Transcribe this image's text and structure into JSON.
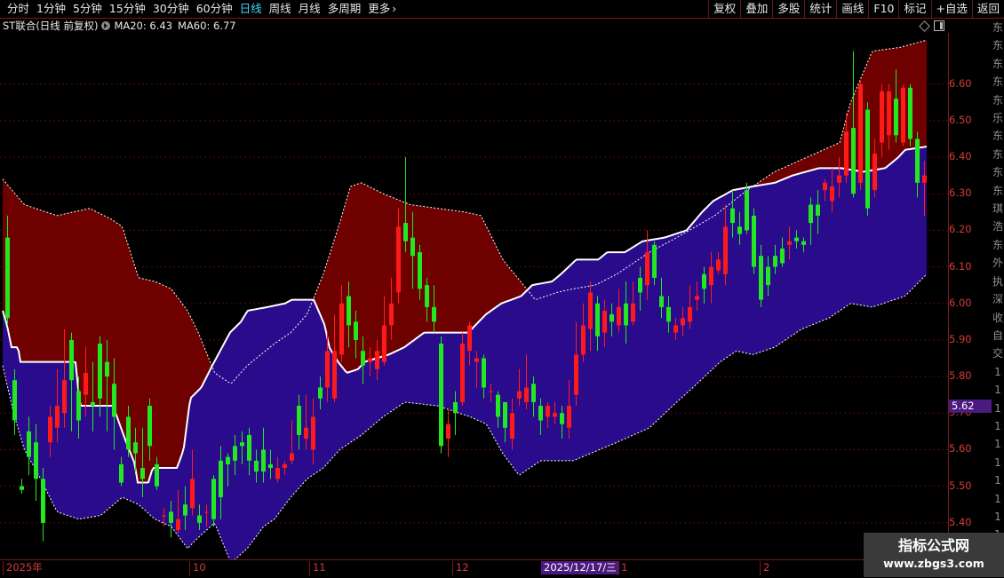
{
  "toolbar": {
    "periods": [
      "分时",
      "1分钟",
      "5分钟",
      "15分钟",
      "30分钟",
      "60分钟",
      "日线",
      "周线",
      "月线",
      "多周期",
      "更多"
    ],
    "active_period": "日线",
    "tools": [
      "复权",
      "叠加",
      "多股",
      "统计",
      "画线",
      "F10",
      "标记",
      "+自选",
      "返回"
    ]
  },
  "info": {
    "symbol": "ST联合(日线 前复权)",
    "ma20": "MA20: 6.43",
    "ma60": "MA60: 6.77"
  },
  "y_axis": {
    "labels": [
      "6.60",
      "6.50",
      "6.40",
      "6.30",
      "6.20",
      "6.10",
      "6.00",
      "5.90",
      "5.80",
      "5.70",
      "5.60",
      "5.50",
      "5.40"
    ],
    "current_price": "5.62"
  },
  "x_axis": {
    "labels": [
      "2025年",
      "10",
      "11",
      "12",
      "1",
      "2"
    ],
    "cursor_date": "2025/12/17/三"
  },
  "right_strip": [
    "东",
    "东",
    "东",
    "东",
    "东",
    "乐",
    "东",
    "东",
    "东",
    "东",
    "琪",
    "浩",
    "东",
    "外",
    "执",
    "深",
    "收",
    "自",
    "交",
    "1",
    "1",
    "1",
    "1",
    "1",
    "1",
    "1",
    "1",
    "1",
    "1",
    "1"
  ],
  "watermark": {
    "title": "指标公式网",
    "url": "www.zbgs3.com"
  },
  "colors": {
    "up": "#ff1a1a",
    "down": "#22e822",
    "upper_band": "#6e0000",
    "lower_band": "#2a0b8c",
    "mid_line": "#ffffff",
    "accent": "#3fd9ff"
  },
  "chart_data": {
    "type": "candlestick",
    "y_range": [
      5.3,
      6.74
    ],
    "count": 140,
    "band": {
      "upper": [
        [
          0,
          6.34
        ],
        [
          8,
          6.27
        ],
        [
          20,
          6.24
        ],
        [
          32,
          6.26
        ],
        [
          40,
          6.23
        ],
        [
          44,
          6.21
        ],
        [
          50,
          6.07
        ],
        [
          56,
          6.06
        ],
        [
          62,
          6.04
        ],
        [
          68,
          5.98
        ],
        [
          72,
          5.92
        ],
        [
          78,
          5.81
        ],
        [
          84,
          5.78
        ],
        [
          90,
          5.83
        ],
        [
          100,
          5.89
        ],
        [
          106,
          5.92
        ],
        [
          112,
          5.97
        ],
        [
          118,
          6.08
        ],
        [
          124,
          6.22
        ],
        [
          128,
          6.32
        ],
        [
          132,
          6.33
        ],
        [
          140,
          6.3
        ],
        [
          150,
          6.27
        ],
        [
          160,
          6.26
        ],
        [
          170,
          6.25
        ],
        [
          176,
          6.24
        ],
        [
          184,
          6.12
        ],
        [
          196,
          6.01
        ],
        [
          204,
          6.03
        ],
        [
          210,
          6.04
        ],
        [
          218,
          6.05
        ],
        [
          226,
          6.08
        ],
        [
          238,
          6.14
        ],
        [
          248,
          6.18
        ],
        [
          262,
          6.24
        ],
        [
          274,
          6.31
        ],
        [
          284,
          6.36
        ],
        [
          296,
          6.4
        ],
        [
          308,
          6.44
        ],
        [
          312,
          6.55
        ],
        [
          320,
          6.69
        ],
        [
          330,
          6.7
        ],
        [
          340,
          6.72
        ]
      ],
      "lower": [
        [
          0,
          5.83
        ],
        [
          4,
          5.7
        ],
        [
          8,
          5.6
        ],
        [
          14,
          5.52
        ],
        [
          20,
          5.43
        ],
        [
          28,
          5.41
        ],
        [
          36,
          5.42
        ],
        [
          44,
          5.47
        ],
        [
          50,
          5.45
        ],
        [
          56,
          5.41
        ],
        [
          62,
          5.39
        ],
        [
          68,
          5.33
        ],
        [
          72,
          5.36
        ],
        [
          78,
          5.4
        ],
        [
          84,
          5.29
        ],
        [
          90,
          5.33
        ],
        [
          96,
          5.39
        ],
        [
          100,
          5.41
        ],
        [
          106,
          5.47
        ],
        [
          112,
          5.52
        ],
        [
          118,
          5.55
        ],
        [
          124,
          5.6
        ],
        [
          132,
          5.64
        ],
        [
          140,
          5.69
        ],
        [
          148,
          5.73
        ],
        [
          160,
          5.72
        ],
        [
          172,
          5.69
        ],
        [
          178,
          5.67
        ],
        [
          184,
          5.59
        ],
        [
          190,
          5.53
        ],
        [
          198,
          5.57
        ],
        [
          210,
          5.57
        ],
        [
          226,
          5.62
        ],
        [
          238,
          5.66
        ],
        [
          248,
          5.73
        ],
        [
          254,
          5.77
        ],
        [
          264,
          5.84
        ],
        [
          270,
          5.87
        ],
        [
          276,
          5.86
        ],
        [
          284,
          5.88
        ],
        [
          294,
          5.93
        ],
        [
          304,
          5.96
        ],
        [
          312,
          6.0
        ],
        [
          320,
          5.99
        ],
        [
          332,
          6.02
        ],
        [
          340,
          6.08
        ]
      ],
      "mid": [
        [
          0,
          5.98
        ],
        [
          4,
          5.94
        ],
        [
          8,
          5.88
        ],
        [
          14,
          5.88
        ],
        [
          16,
          5.84
        ],
        [
          30,
          5.84
        ],
        [
          52,
          5.84
        ],
        [
          66,
          5.84
        ],
        [
          70,
          5.72
        ],
        [
          100,
          5.72
        ],
        [
          112,
          5.62
        ],
        [
          120,
          5.56
        ],
        [
          122,
          5.51
        ],
        [
          132,
          5.51
        ],
        [
          136,
          5.55
        ],
        [
          158,
          5.55
        ],
        [
          164,
          5.6
        ],
        [
          170,
          5.74
        ],
        [
          180,
          5.77
        ],
        [
          190,
          5.83
        ],
        [
          206,
          5.92
        ],
        [
          216,
          5.95
        ],
        [
          222,
          5.98
        ],
        [
          240,
          5.99
        ],
        [
          256,
          6.0
        ],
        [
          262,
          6.01
        ],
        [
          282,
          6.01
        ],
        [
          292,
          5.94
        ],
        [
          296,
          5.88
        ],
        [
          304,
          5.84
        ],
        [
          312,
          5.81
        ],
        [
          322,
          5.82
        ],
        [
          328,
          5.84
        ],
        [
          350,
          5.86
        ],
        [
          364,
          5.88
        ],
        [
          382,
          5.92
        ],
        [
          422,
          5.92
        ],
        [
          438,
          5.97
        ],
        [
          452,
          6.0
        ],
        [
          470,
          6.02
        ],
        [
          480,
          6.05
        ],
        [
          498,
          6.06
        ],
        [
          506,
          6.08
        ],
        [
          520,
          6.12
        ],
        [
          540,
          6.12
        ],
        [
          548,
          6.14
        ],
        [
          564,
          6.14
        ],
        [
          580,
          6.17
        ],
        [
          600,
          6.18
        ],
        [
          620,
          6.2
        ],
        [
          634,
          6.25
        ],
        [
          644,
          6.28
        ],
        [
          662,
          6.31
        ],
        [
          680,
          6.32
        ],
        [
          700,
          6.33
        ],
        [
          716,
          6.35
        ],
        [
          740,
          6.37
        ],
        [
          760,
          6.37
        ],
        [
          780,
          6.36
        ],
        [
          800,
          6.37
        ],
        [
          812,
          6.4
        ],
        [
          818,
          6.42
        ],
        [
          840,
          6.43
        ]
      ]
    },
    "candles": [
      [
        6.18,
        5.96,
        6.24,
        5.94
      ],
      [
        5.79,
        5.68,
        5.82,
        5.64
      ],
      [
        5.5,
        5.49,
        5.52,
        5.48
      ],
      [
        5.65,
        5.58,
        5.69,
        5.53
      ],
      [
        5.62,
        5.52,
        5.67,
        5.46
      ],
      [
        5.52,
        5.4,
        5.55,
        5.35
      ],
      [
        5.62,
        5.69,
        5.72,
        5.58
      ],
      [
        5.66,
        5.72,
        5.82,
        5.62
      ],
      [
        5.7,
        5.79,
        5.93,
        5.66
      ],
      [
        5.9,
        5.79,
        5.92,
        5.65
      ],
      [
        5.76,
        5.68,
        5.8,
        5.63
      ],
      [
        5.75,
        5.81,
        5.88,
        5.69
      ],
      [
        5.73,
        5.72,
        5.84,
        5.65
      ],
      [
        5.89,
        5.74,
        5.91,
        5.69
      ],
      [
        5.84,
        5.8,
        5.9,
        5.65
      ],
      [
        5.78,
        5.69,
        5.85,
        5.6
      ],
      [
        5.56,
        5.51,
        5.58,
        5.5
      ],
      [
        5.69,
        5.6,
        5.72,
        5.58
      ],
      [
        5.62,
        5.59,
        5.66,
        5.54
      ],
      [
        5.55,
        5.52,
        5.66,
        5.47
      ],
      [
        5.72,
        5.61,
        5.74,
        5.57
      ],
      [
        5.56,
        5.5,
        5.58,
        5.49
      ],
      [
        5.42,
        5.42,
        5.44,
        5.39
      ],
      [
        5.43,
        5.4,
        5.46,
        5.36
      ],
      [
        5.38,
        5.41,
        5.49,
        5.37
      ],
      [
        5.45,
        5.42,
        5.5,
        5.38
      ],
      [
        5.44,
        5.52,
        5.6,
        5.42
      ],
      [
        5.42,
        5.4,
        5.45,
        5.38
      ],
      [
        5.43,
        5.43,
        5.45,
        5.39
      ],
      [
        5.52,
        5.41,
        5.53,
        5.39
      ],
      [
        5.57,
        5.47,
        5.61,
        5.41
      ],
      [
        5.58,
        5.56,
        5.59,
        5.5
      ],
      [
        5.61,
        5.57,
        5.64,
        5.53
      ],
      [
        5.62,
        5.61,
        5.65,
        5.56
      ],
      [
        5.64,
        5.57,
        5.66,
        5.53
      ],
      [
        5.57,
        5.54,
        5.6,
        5.51
      ],
      [
        5.6,
        5.54,
        5.66,
        5.51
      ],
      [
        5.56,
        5.55,
        5.6,
        5.52
      ],
      [
        5.52,
        5.55,
        5.58,
        5.51
      ],
      [
        5.55,
        5.56,
        5.57,
        5.53
      ],
      [
        5.57,
        5.59,
        5.68,
        5.56
      ],
      [
        5.72,
        5.64,
        5.75,
        5.6
      ],
      [
        5.63,
        5.66,
        5.75,
        5.6
      ],
      [
        5.6,
        5.69,
        5.74,
        5.56
      ],
      [
        5.77,
        5.74,
        5.8,
        5.71
      ],
      [
        5.77,
        5.87,
        5.92,
        5.73
      ],
      [
        5.74,
        5.87,
        5.97,
        5.73
      ],
      [
        5.86,
        6.0,
        6.05,
        5.84
      ],
      [
        6.02,
        5.94,
        6.06,
        5.88
      ],
      [
        5.95,
        5.9,
        5.98,
        5.85
      ],
      [
        5.87,
        5.83,
        5.91,
        5.78
      ],
      [
        5.84,
        5.85,
        5.88,
        5.8
      ],
      [
        5.82,
        5.87,
        5.9,
        5.79
      ],
      [
        5.84,
        5.94,
        6.02,
        5.83
      ],
      [
        5.94,
        6.0,
        6.07,
        5.9
      ],
      [
        6.03,
        6.21,
        6.26,
        6.0
      ],
      [
        6.22,
        6.17,
        6.4,
        6.14
      ],
      [
        6.18,
        6.13,
        6.25,
        6.04
      ],
      [
        6.14,
        6.04,
        6.16,
        6.01
      ],
      [
        6.05,
        5.99,
        6.07,
        5.95
      ],
      [
        5.99,
        5.95,
        6.05,
        5.92
      ],
      [
        5.89,
        5.61,
        5.91,
        5.59
      ],
      [
        5.63,
        5.67,
        5.71,
        5.58
      ],
      [
        5.73,
        5.7,
        5.76,
        5.64
      ],
      [
        5.73,
        5.89,
        5.92,
        5.72
      ],
      [
        5.87,
        5.94,
        5.95,
        5.83
      ],
      [
        5.84,
        5.85,
        5.87,
        5.77
      ],
      [
        5.85,
        5.77,
        5.86,
        5.74
      ],
      [
        5.76,
        5.76,
        5.78,
        5.73
      ],
      [
        5.75,
        5.69,
        5.76,
        5.66
      ],
      [
        5.73,
        5.66,
        5.73,
        5.62
      ],
      [
        5.63,
        5.7,
        5.74,
        5.6
      ],
      [
        5.74,
        5.76,
        5.82,
        5.72
      ],
      [
        5.73,
        5.77,
        5.86,
        5.71
      ],
      [
        5.78,
        5.73,
        5.8,
        5.69
      ],
      [
        5.72,
        5.68,
        5.74,
        5.64
      ],
      [
        5.69,
        5.72,
        5.73,
        5.66
      ],
      [
        5.69,
        5.7,
        5.73,
        5.67
      ],
      [
        5.7,
        5.67,
        5.72,
        5.63
      ],
      [
        5.66,
        5.72,
        5.79,
        5.63
      ],
      [
        5.75,
        5.86,
        5.95,
        5.72
      ],
      [
        5.86,
        5.94,
        6.0,
        5.84
      ],
      [
        5.93,
        6.03,
        6.06,
        5.87
      ],
      [
        6.0,
        5.91,
        6.02,
        5.87
      ],
      [
        5.92,
        5.98,
        6.01,
        5.88
      ],
      [
        5.97,
        5.95,
        6.0,
        5.91
      ],
      [
        5.94,
        5.99,
        6.04,
        5.92
      ],
      [
        6.0,
        5.94,
        6.06,
        5.89
      ],
      [
        5.95,
        6.0,
        6.06,
        5.94
      ],
      [
        6.07,
        6.03,
        6.1,
        5.98
      ],
      [
        6.05,
        6.14,
        6.2,
        6.01
      ],
      [
        6.16,
        6.07,
        6.17,
        6.05
      ],
      [
        6.02,
        5.99,
        6.07,
        5.96
      ],
      [
        5.99,
        5.95,
        6.02,
        5.92
      ],
      [
        5.92,
        5.94,
        5.96,
        5.9
      ],
      [
        5.94,
        5.96,
        5.99,
        5.91
      ],
      [
        5.95,
        5.99,
        6.05,
        5.93
      ],
      [
        6.01,
        6.02,
        6.06,
        5.98
      ],
      [
        6.08,
        6.04,
        6.1,
        6.0
      ],
      [
        6.05,
        6.1,
        6.14,
        6.0
      ],
      [
        6.09,
        6.12,
        6.14,
        6.08
      ],
      [
        6.08,
        6.21,
        6.27,
        6.05
      ],
      [
        6.26,
        6.22,
        6.31,
        6.18
      ],
      [
        6.21,
        6.19,
        6.25,
        6.16
      ],
      [
        6.31,
        6.2,
        6.33,
        6.19
      ],
      [
        6.24,
        6.1,
        6.26,
        6.08
      ],
      [
        6.13,
        6.01,
        6.16,
        5.99
      ],
      [
        6.1,
        6.05,
        6.13,
        6.02
      ],
      [
        6.13,
        6.1,
        6.16,
        6.08
      ],
      [
        6.15,
        6.11,
        6.18,
        6.1
      ],
      [
        6.16,
        6.17,
        6.21,
        6.12
      ],
      [
        6.18,
        6.17,
        6.2,
        6.15
      ],
      [
        6.17,
        6.16,
        6.18,
        6.14
      ],
      [
        6.27,
        6.22,
        6.29,
        6.16
      ],
      [
        6.27,
        6.24,
        6.31,
        6.19
      ],
      [
        6.31,
        6.33,
        6.34,
        6.28
      ],
      [
        6.28,
        6.32,
        6.37,
        6.25
      ],
      [
        6.33,
        6.35,
        6.4,
        6.29
      ],
      [
        6.35,
        6.47,
        6.52,
        6.33
      ],
      [
        6.48,
        6.3,
        6.69,
        6.29
      ],
      [
        6.33,
        6.6,
        6.61,
        6.31
      ],
      [
        6.53,
        6.26,
        6.55,
        6.24
      ],
      [
        6.31,
        6.41,
        6.45,
        6.29
      ],
      [
        6.44,
        6.58,
        6.6,
        6.4
      ],
      [
        6.46,
        6.58,
        6.6,
        6.42
      ],
      [
        6.56,
        6.46,
        6.64,
        6.44
      ],
      [
        6.44,
        6.59,
        6.6,
        6.43
      ],
      [
        6.59,
        6.45,
        6.6,
        6.43
      ],
      [
        6.45,
        6.33,
        6.47,
        6.29
      ],
      [
        6.33,
        6.35,
        6.39,
        6.24
      ]
    ]
  }
}
